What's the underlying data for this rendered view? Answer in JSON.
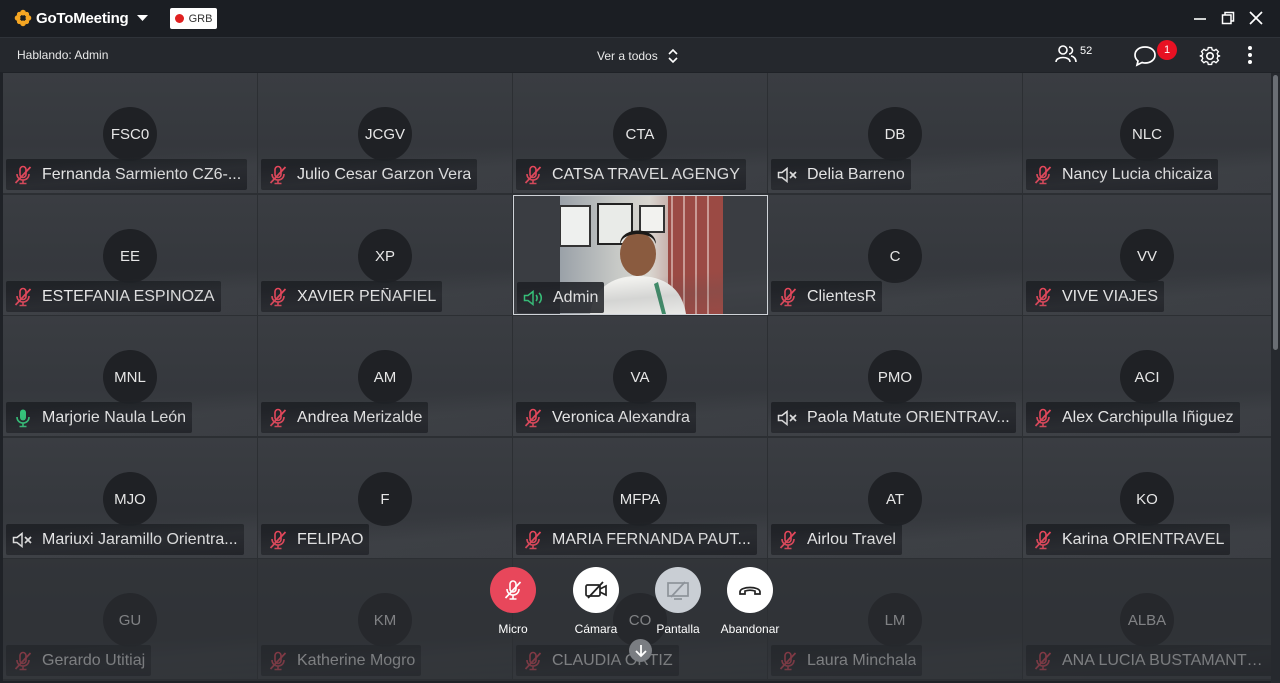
{
  "app": {
    "name": "GoToMeeting",
    "recording_label": "GRB"
  },
  "toolbar": {
    "speaking": "Hablando: Admin",
    "view_label": "Ver a todos",
    "participant_count": "52",
    "chat_badge": "1"
  },
  "colors": {
    "mic_muted": "#e8475b",
    "end_call": "#e8475b",
    "speaking_green": "#34c77b",
    "recording": "#e02020"
  },
  "tiles": [
    {
      "initials": "FSC0",
      "name": "Fernanda Sarmiento CZ6-...",
      "mic": "muted"
    },
    {
      "initials": "JCGV",
      "name": "Julio Cesar Garzon Vera",
      "mic": "muted"
    },
    {
      "initials": "CTA",
      "name": "CATSA TRAVEL AGENGY",
      "mic": "muted"
    },
    {
      "initials": "DB",
      "name": "Delia Barreno",
      "mic": "speaker-off"
    },
    {
      "initials": "NLC",
      "name": "Nancy Lucia chicaiza",
      "mic": "muted"
    },
    {
      "initials": "EE",
      "name": "ESTEFANIA ESPINOZA",
      "mic": "muted"
    },
    {
      "initials": "XP",
      "name": "XAVIER PEÑAFIEL",
      "mic": "muted"
    },
    {
      "initials": "",
      "name": "Admin",
      "mic": "speaking",
      "video": true
    },
    {
      "initials": "C",
      "name": "ClientesR",
      "mic": "muted"
    },
    {
      "initials": "VV",
      "name": "VIVE VIAJES",
      "mic": "muted"
    },
    {
      "initials": "MNL",
      "name": "Marjorie Naula León",
      "mic": "on"
    },
    {
      "initials": "AM",
      "name": "Andrea Merizalde",
      "mic": "muted"
    },
    {
      "initials": "VA",
      "name": "Veronica Alexandra",
      "mic": "muted"
    },
    {
      "initials": "PMO",
      "name": "Paola Matute ORIENTRAV...",
      "mic": "speaker-off"
    },
    {
      "initials": "ACI",
      "name": "Alex Carchipulla Iñiguez",
      "mic": "muted"
    },
    {
      "initials": "MJO",
      "name": "Mariuxi Jaramillo Orientra...",
      "mic": "speaker-off"
    },
    {
      "initials": "F",
      "name": "FELIPAO",
      "mic": "muted"
    },
    {
      "initials": "MFPA",
      "name": "MARIA FERNANDA PAUT...",
      "mic": "muted"
    },
    {
      "initials": "AT",
      "name": "Airlou Travel",
      "mic": "muted"
    },
    {
      "initials": "KO",
      "name": "Karina ORIENTRAVEL",
      "mic": "muted"
    },
    {
      "initials": "GU",
      "name": "Gerardo Utitiaj",
      "mic": "muted"
    },
    {
      "initials": "KM",
      "name": "Katherine Mogro",
      "mic": "muted"
    },
    {
      "initials": "CO",
      "name": "CLAUDIA ORTIZ",
      "mic": "muted"
    },
    {
      "initials": "LM",
      "name": "Laura Minchala",
      "mic": "muted"
    },
    {
      "initials": "ALBA",
      "name": "ANA LUCIA BUSTAMANTE...",
      "mic": "muted"
    }
  ],
  "controls": [
    {
      "key": "micro",
      "label": "Micro",
      "icon": "mic-off-icon"
    },
    {
      "key": "camera",
      "label": "Cámara",
      "icon": "camera-off-icon"
    },
    {
      "key": "screen",
      "label": "Pantalla",
      "icon": "screen-share-icon"
    },
    {
      "key": "leave",
      "label": "Abandonar",
      "icon": "hang-up-icon"
    }
  ]
}
